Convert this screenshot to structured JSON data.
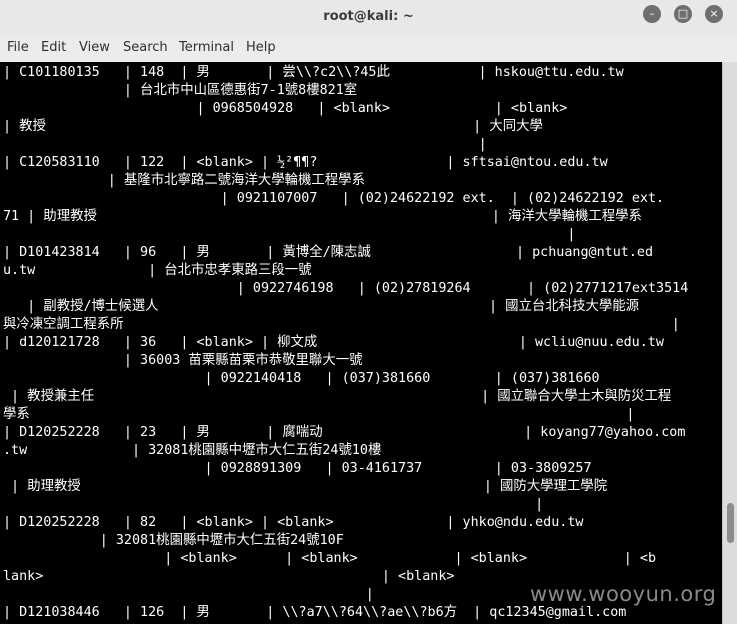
{
  "window": {
    "title": "root@kali: ~",
    "minimize_glyph": "–",
    "maximize_glyph": "□",
    "close_glyph": "×"
  },
  "menu": [
    "File",
    "Edit",
    "View",
    "Search",
    "Terminal",
    "Help"
  ],
  "terminal": {
    "lines": [
      "| C101180135   | 148  | 男       | 尝\\\\?c2\\\\?45此           | hskou@ttu.edu.tw",
      "               | 台北市中山區德惠街7-1號8樓821室",
      "                        | 0968504928   | <blank>             | <blank>",
      "| 教授                                                     | 大同大學",
      "                                                           |",
      "| C120583110   | 122  | <blank> | ½²¶¶?                | sftsai@ntou.edu.tw",
      "             | 基隆市北寧路二號海洋大學輪機工程學系",
      "                           | 0921107007   | (02)24622192 ext.  | (02)24622192 ext.",
      "71 | 助理教授                                                 | 海洋大學輪機工程學系",
      "                                                                      |",
      "| D101423814   | 96   | 男       | 黃博全/陳志誠                  | pchuang@ntut.ed",
      "u.tw              | 台北市忠孝東路三段一號",
      "                             | 0922746198   | (02)27819264       | (02)2771217ext3514",
      "   | 副教授/博士候選人                                         | 國立台北科技大學能源",
      "與冷凍空調工程系所                                                                    |",
      "| d120121728   | 36   | <blank> | 柳文成                         | wcliu@nuu.edu.tw",
      "               | 36003 苗栗縣苗栗市恭敬里聯大一號",
      "                         | 0922140418   | (037)381660        | (037)381660",
      " | 教授兼主任                                                | 國立聯合大學土木與防災工程",
      "學系                                                                          |",
      "| D120252228   | 23   | 男       | 腐喘动                         | koyang77@yahoo.com",
      ".tw             | 32081桃園縣中壢市大仁五街24號10樓",
      "                         | 0928891309   | 03-4161737         | 03-3809257",
      " | 助理教授                                                  | 國防大學理工學院",
      "                                                                  |",
      "| D120252228   | 82   | <blank> | <blank>              | yhko@ndu.edu.tw",
      "            | 32081桃園縣中壢市大仁五街24號10F",
      "                    | <blank>      | <blank>            | <blank>            | <b",
      "lank>                                          | <blank>",
      "                                             |",
      "| D121038446   | 126  | 男       | \\\\?a7\\\\?64\\\\?ae\\\\?b6方  | qc12345@gmail.com"
    ]
  },
  "watermark": "www.wooyun.org"
}
